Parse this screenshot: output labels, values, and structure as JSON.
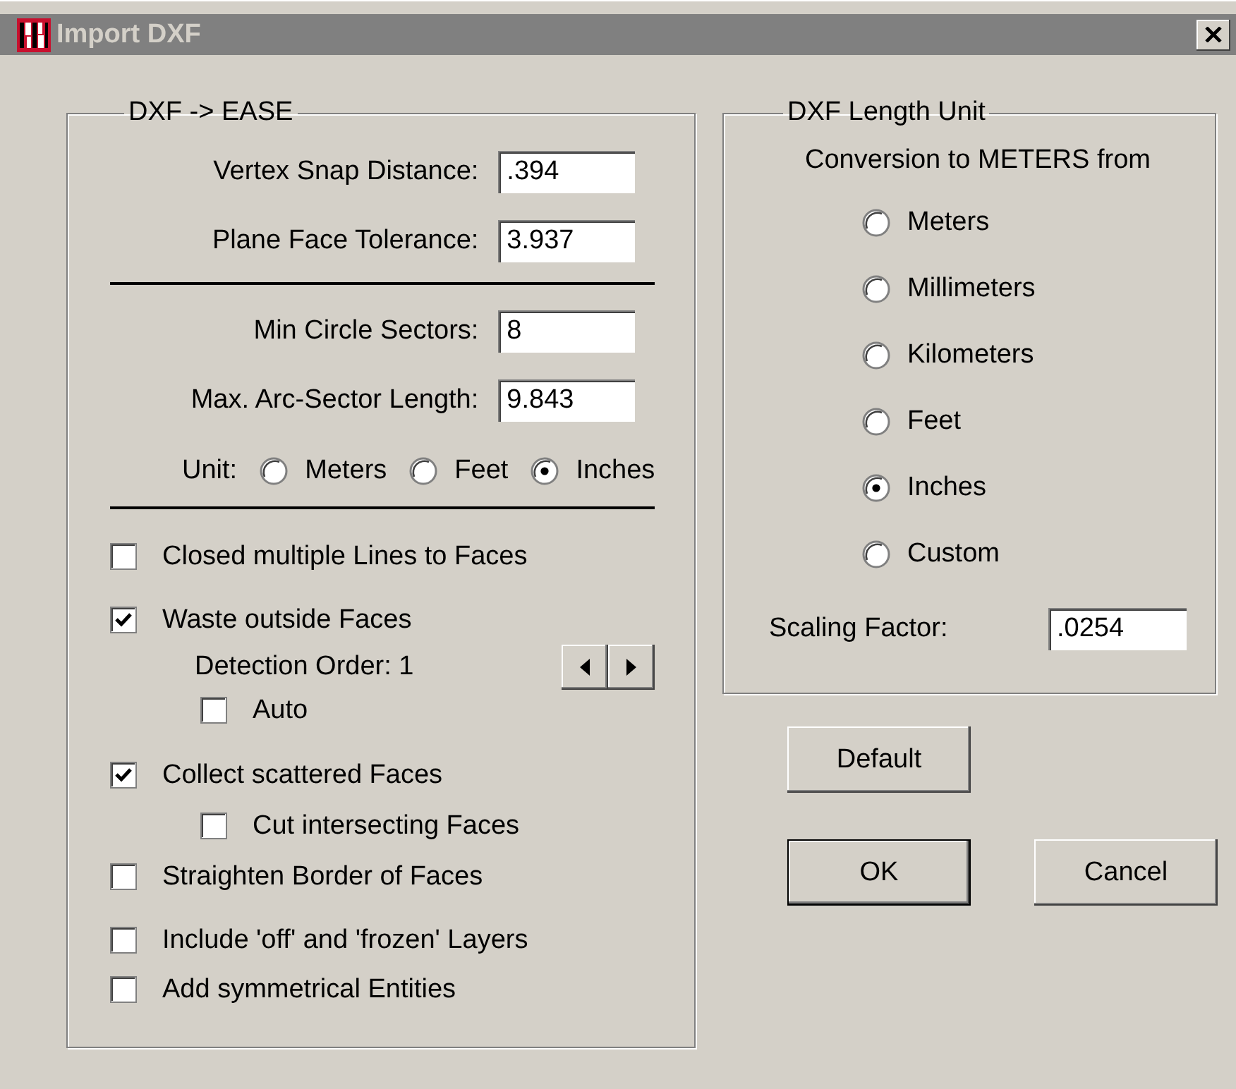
{
  "window": {
    "title": "Import DXF"
  },
  "dxf_to_ease": {
    "title": "DXF -> EASE",
    "field_groups": [
      [
        {
          "label": "Vertex Snap Distance:",
          "value": ".394"
        },
        {
          "label": "Plane Face Tolerance:",
          "value": "3.937"
        }
      ],
      [
        {
          "label": "Min Circle Sectors:",
          "value": "8"
        },
        {
          "label": "Max. Arc-Sector Length:",
          "value": "9.843"
        }
      ]
    ],
    "unit": {
      "label": "Unit:",
      "options": [
        {
          "label": "Meters",
          "selected": false
        },
        {
          "label": "Feet",
          "selected": false
        },
        {
          "label": "Inches",
          "selected": true
        }
      ]
    },
    "option_groups": [
      [
        {
          "kind": "checkbox",
          "label": "Closed multiple Lines to Faces",
          "checked": false
        }
      ],
      [
        {
          "kind": "checkbox",
          "label": "Waste outside Faces",
          "checked": true,
          "children": [
            {
              "kind": "stepper",
              "label": "Detection Order: 1"
            },
            {
              "kind": "checkbox",
              "label": "Auto",
              "checked": false
            }
          ]
        }
      ],
      [
        {
          "kind": "checkbox",
          "label": "Collect scattered Faces",
          "checked": true,
          "children": [
            {
              "kind": "checkbox",
              "label": "Cut intersecting Faces",
              "checked": false
            }
          ]
        },
        {
          "kind": "checkbox",
          "label": "Straighten Border of Faces",
          "checked": false
        }
      ],
      [
        {
          "kind": "checkbox",
          "label": "Include 'off' and 'frozen' Layers",
          "checked": false
        },
        {
          "kind": "checkbox",
          "label": "Add  symmetrical Entities",
          "checked": false
        }
      ]
    ]
  },
  "dxf_length_unit": {
    "title": "DXF Length Unit",
    "caption": "Conversion to METERS from",
    "options": [
      {
        "label": "Meters",
        "selected": false
      },
      {
        "label": "Millimeters",
        "selected": false
      },
      {
        "label": "Kilometers",
        "selected": false
      },
      {
        "label": "Feet",
        "selected": false
      },
      {
        "label": "Inches",
        "selected": true
      },
      {
        "label": "Custom",
        "selected": false
      }
    ],
    "scaling_factor": {
      "label": "Scaling Factor:",
      "value": ".0254"
    }
  },
  "buttons": [
    {
      "label": "Default",
      "default": false
    },
    {
      "label": "OK",
      "default": true
    },
    {
      "label": "Cancel",
      "default": false
    }
  ]
}
